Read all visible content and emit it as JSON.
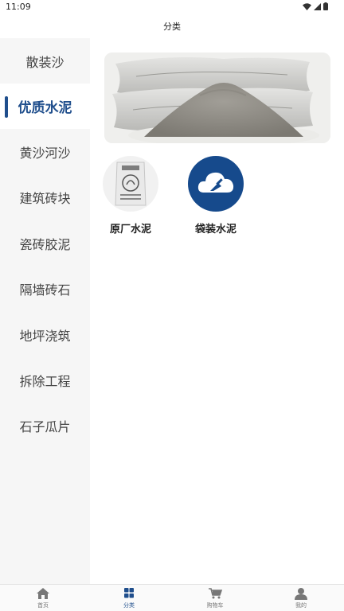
{
  "status_bar": {
    "time": "11:09"
  },
  "header": {
    "title": "分类"
  },
  "sidebar": {
    "items": [
      {
        "label": "散装沙"
      },
      {
        "label": "优质水泥",
        "active": true
      },
      {
        "label": "黄沙河沙"
      },
      {
        "label": "建筑砖块"
      },
      {
        "label": "瓷砖胶泥"
      },
      {
        "label": "隔墙砖石"
      },
      {
        "label": "地坪浇筑"
      },
      {
        "label": "拆除工程"
      },
      {
        "label": "石子瓜片"
      }
    ]
  },
  "main": {
    "products": [
      {
        "label": "原厂水泥",
        "icon": "cement-bag-image"
      },
      {
        "label": "袋装水泥",
        "icon": "cloud-trowel-icon"
      }
    ]
  },
  "tabbar": {
    "items": [
      {
        "label": "首页",
        "icon": "home-icon"
      },
      {
        "label": "分类",
        "icon": "category-grid-icon",
        "active": true
      },
      {
        "label": "购物车",
        "icon": "cart-icon"
      },
      {
        "label": "我的",
        "icon": "user-icon"
      }
    ]
  },
  "colors": {
    "accent": "#1f4e8c",
    "sidebar_bg": "#f6f6f6"
  }
}
